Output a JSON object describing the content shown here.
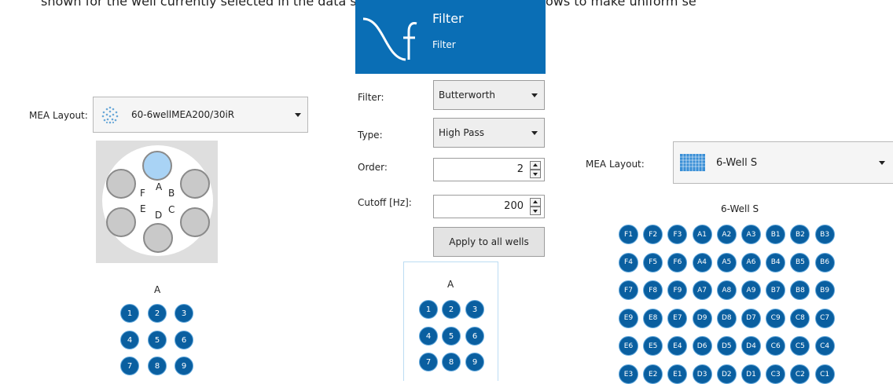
{
  "caption": "shown for the well currently selected in the data source. An Apply to all wells allows to make uniform se",
  "left": {
    "mea_label": "MEA Layout:",
    "mea_value": "60-6wellMEA200/30iR",
    "wells": [
      "A",
      "B",
      "C",
      "D",
      "E",
      "F"
    ],
    "selected_well": "A",
    "grid_title": "A",
    "electrodes": [
      "1",
      "2",
      "3",
      "4",
      "5",
      "6",
      "7",
      "8",
      "9"
    ]
  },
  "filter": {
    "title": "Filter",
    "subtitle": "Filter",
    "icon": "filter-curve-icon",
    "filter_label": "Filter:",
    "filter_value": "Butterworth",
    "type_label": "Type:",
    "type_value": "High Pass",
    "order_label": "Order:",
    "order_value": "2",
    "cutoff_label": "Cutoff [Hz]:",
    "cutoff_value": "200",
    "apply_label": "Apply to all wells",
    "grid_title": "A",
    "electrodes": [
      "1",
      "2",
      "3",
      "4",
      "5",
      "6",
      "7",
      "8",
      "9"
    ]
  },
  "right": {
    "mea_label": "MEA Layout:",
    "mea_value": "6-Well S",
    "grid_title": "6-Well S",
    "rows": [
      [
        "F1",
        "F2",
        "F3",
        "A1",
        "A2",
        "A3",
        "B1",
        "B2",
        "B3"
      ],
      [
        "F4",
        "F5",
        "F6",
        "A4",
        "A5",
        "A6",
        "B4",
        "B5",
        "B6"
      ],
      [
        "F7",
        "F8",
        "F9",
        "A7",
        "A8",
        "A9",
        "B7",
        "B8",
        "B9"
      ],
      [
        "E9",
        "E8",
        "E7",
        "D9",
        "D8",
        "D7",
        "C9",
        "C8",
        "C7"
      ],
      [
        "E6",
        "E5",
        "E4",
        "D6",
        "D5",
        "D4",
        "C6",
        "C5",
        "C4"
      ],
      [
        "E3",
        "E2",
        "E1",
        "D3",
        "D2",
        "D1",
        "C3",
        "C2",
        "C1"
      ]
    ]
  },
  "colors": {
    "header_blue": "#0a6eb5",
    "electrode_blue": "#0a5fa0",
    "selected_well": "#a9d3f5"
  }
}
